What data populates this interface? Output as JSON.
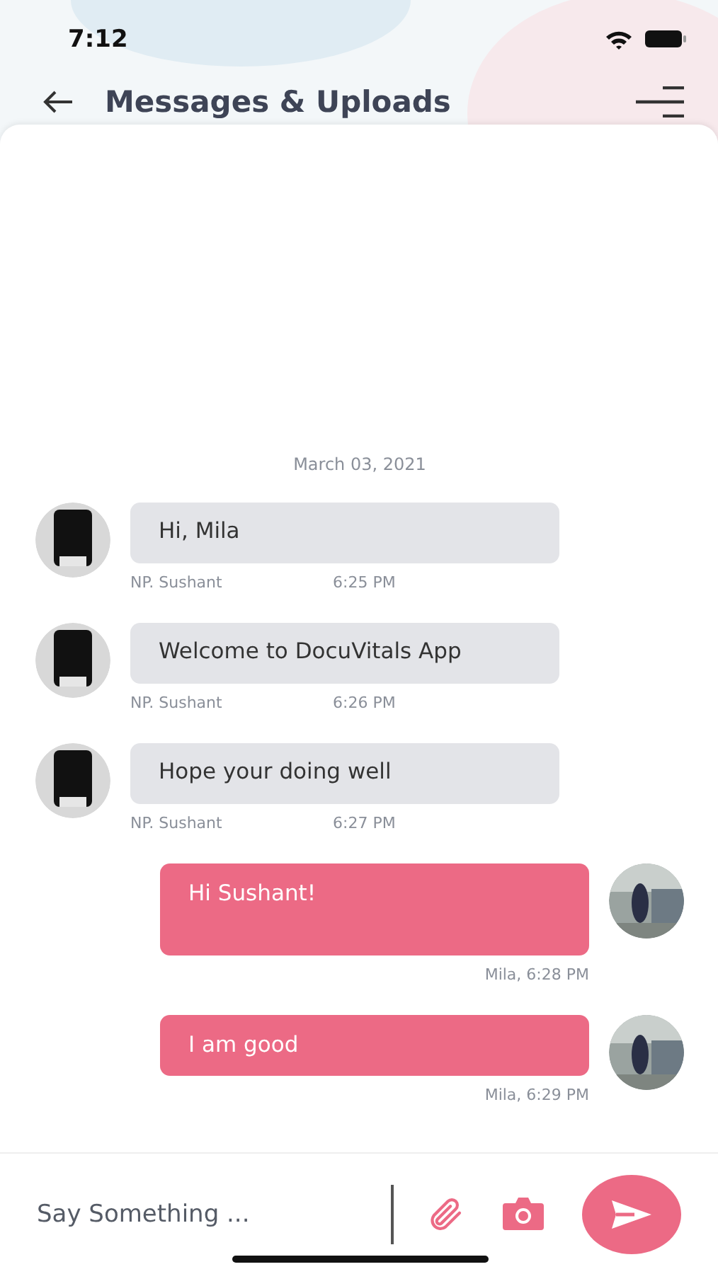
{
  "status_bar": {
    "time": "7:12"
  },
  "header": {
    "title": "Messages & Uploads"
  },
  "date": "March 03, 2021",
  "messages": [
    {
      "kind": "incoming",
      "text": "Hi, Mila",
      "sender": "NP. Sushant",
      "time": "6:25 PM"
    },
    {
      "kind": "incoming",
      "text": "Welcome to DocuVitals App",
      "sender": "NP. Sushant",
      "time": "6:26 PM"
    },
    {
      "kind": "incoming",
      "text": "Hope your doing well",
      "sender": "NP. Sushant",
      "time": "6:27 PM"
    },
    {
      "kind": "outgoing",
      "text": "Hi Sushant!",
      "meta": "Mila, 6:28 PM",
      "tall": true
    },
    {
      "kind": "outgoing",
      "text": "I am good",
      "meta": "Mila, 6:29 PM",
      "tall": false
    }
  ],
  "composer": {
    "placeholder": "Say Something ..."
  }
}
